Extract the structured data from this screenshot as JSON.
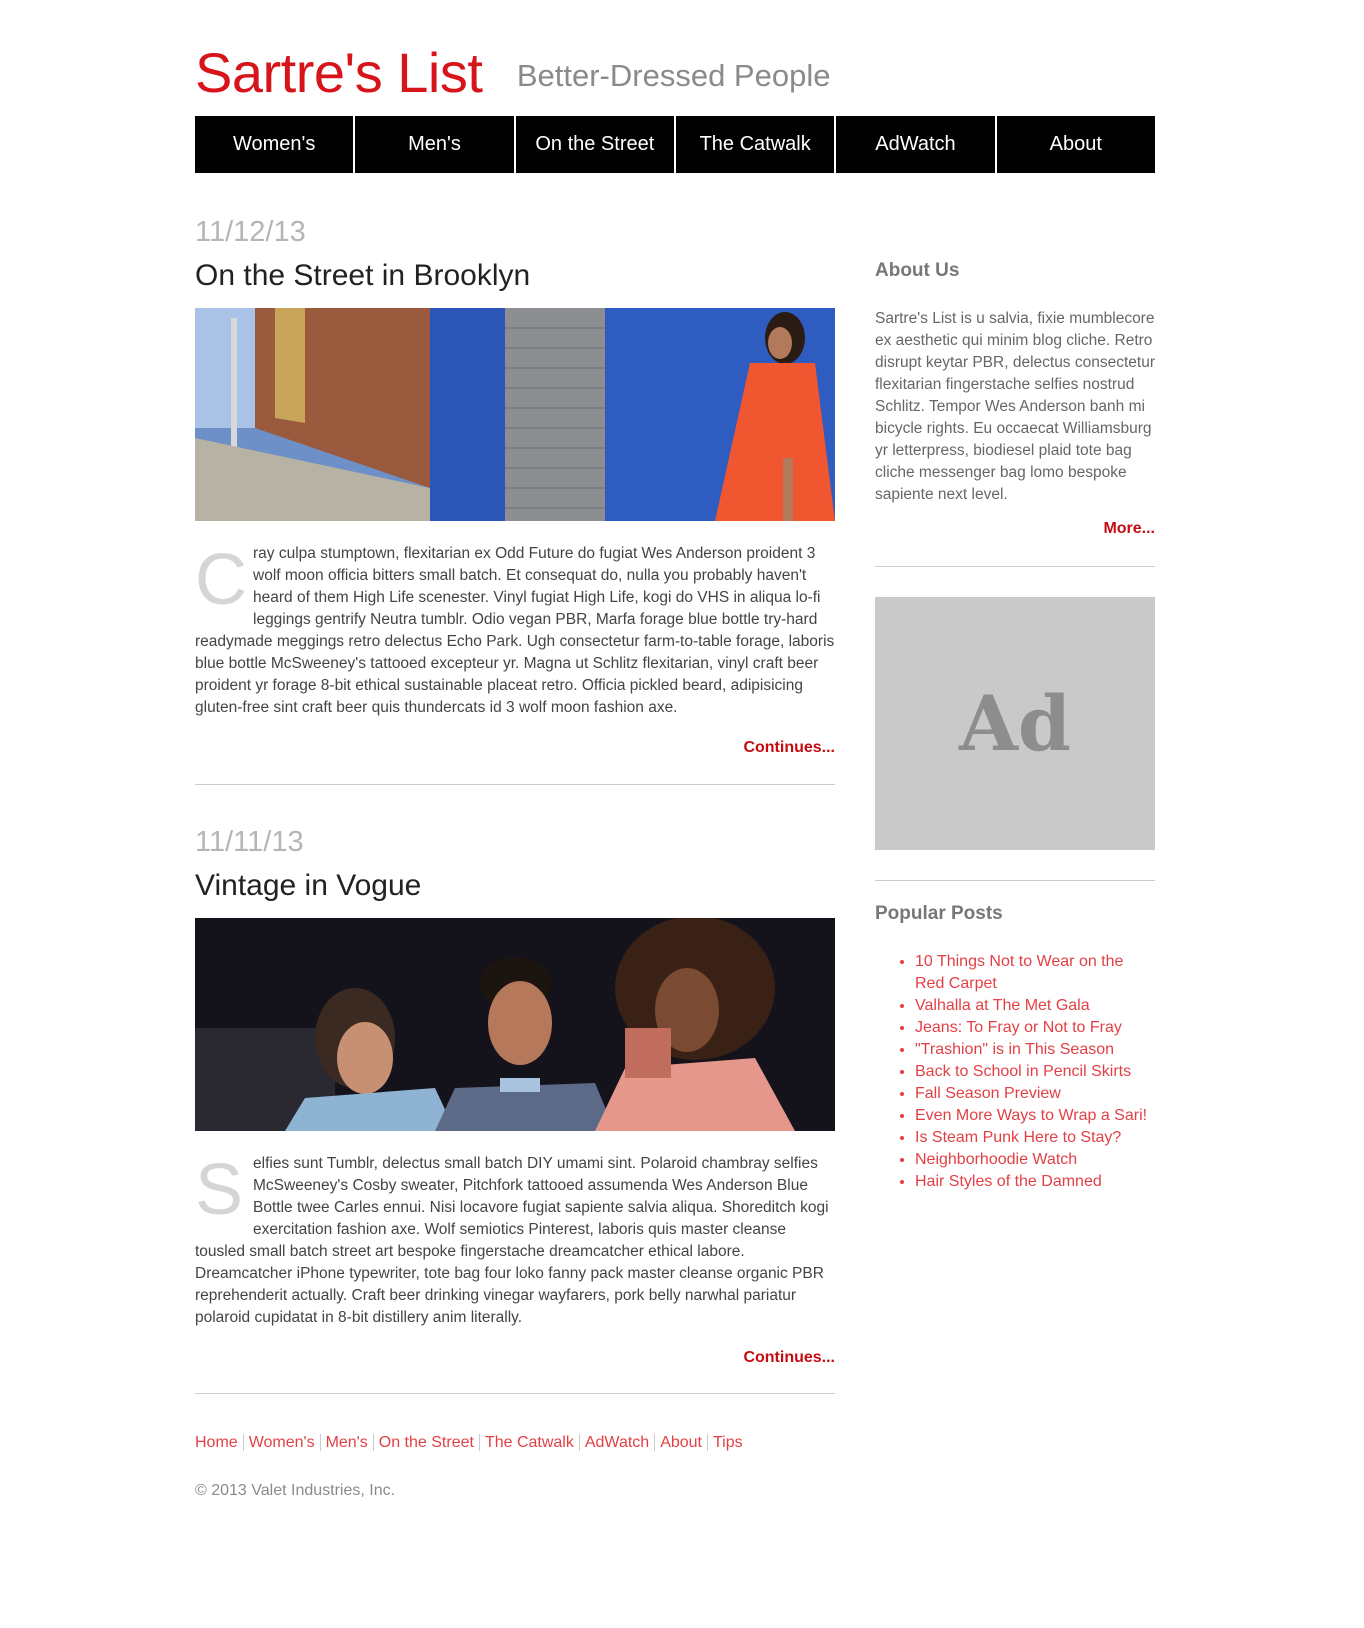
{
  "header": {
    "site_title": "Sartre's List",
    "tagline": "Better-Dressed People"
  },
  "nav": [
    "Women's",
    "Men's",
    "On the Street",
    "The Catwalk",
    "AdWatch",
    "About"
  ],
  "posts": [
    {
      "date": "11/12/13",
      "title": "On the Street in Brooklyn",
      "dropcap": "C",
      "body": "ray culpa stumptown, flexitarian ex Odd Future do fugiat Wes Anderson proident 3 wolf moon officia bitters small batch. Et consequat do, nulla you probably haven't heard of them High Life scenester. Vinyl fugiat High Life, kogi do VHS in aliqua lo-fi leggings gentrify Neutra tumblr. Odio vegan PBR, Marfa forage blue bottle try-hard readymade meggings retro delectus Echo Park. Ugh consectetur farm-to-table forage, laboris blue bottle McSweeney's tattooed excepteur yr. Magna ut Schlitz flexitarian, vinyl craft beer proident yr forage 8-bit ethical sustainable placeat retro. Officia pickled beard, adipisicing gluten-free sint craft beer quis thundercats id 3 wolf moon fashion axe.",
      "continue_label": "Continues..."
    },
    {
      "date": "11/11/13",
      "title": "Vintage in Vogue",
      "dropcap": "S",
      "body": "elfies sunt Tumblr, delectus small batch DIY umami sint. Polaroid chambray selfies McSweeney's Cosby sweater, Pitchfork tattooed assumenda Wes Anderson Blue Bottle twee Carles ennui. Nisi locavore fugiat sapiente salvia aliqua. Shoreditch kogi exercitation fashion axe. Wolf semiotics Pinterest, laboris quis master cleanse tousled small batch street art bespoke fingerstache dreamcatcher ethical labore. Dreamcatcher iPhone typewriter, tote bag four loko fanny pack master cleanse organic PBR reprehenderit actually. Craft beer drinking vinegar wayfarers, pork belly narwhal pariatur polaroid cupidatat in 8-bit distillery anim literally.",
      "continue_label": "Continues..."
    }
  ],
  "sidebar": {
    "about_heading": "About Us",
    "about_text": "Sartre's List is u salvia, fixie mumblecore ex aesthetic qui minim blog cliche. Retro disrupt keytar PBR, delectus consectetur flexitarian fingerstache selfies nostrud Schlitz. Tempor Wes Anderson banh mi bicycle rights. Eu occaecat Williamsburg yr letterpress, biodiesel plaid tote bag cliche messenger bag lomo bespoke sapiente next level.",
    "more_label": "More...",
    "ad_label": "Ad",
    "popular_heading": "Popular Posts",
    "popular_posts": [
      "10 Things Not to Wear on the Red Carpet",
      "Valhalla at The Met Gala",
      "Jeans: To Fray or Not to Fray",
      "\"Trashion\" is in This Season",
      "Back to School in Pencil Skirts",
      "Fall Season Preview",
      "Even More Ways to Wrap a Sari!",
      "Is Steam Punk Here to Stay?",
      "Neighborhoodie Watch",
      "Hair Styles of the Damned"
    ]
  },
  "footer": {
    "links": [
      "Home",
      "Women's",
      "Men's",
      "On the Street",
      "The Catwalk",
      "AdWatch",
      "About",
      "Tips"
    ],
    "copyright": "© 2013 Valet Industries, Inc."
  },
  "colors": {
    "brand_red": "#d7141a",
    "link_red": "#e34045",
    "nav_bg": "#000000",
    "ad_bg": "#c9c9c9"
  }
}
